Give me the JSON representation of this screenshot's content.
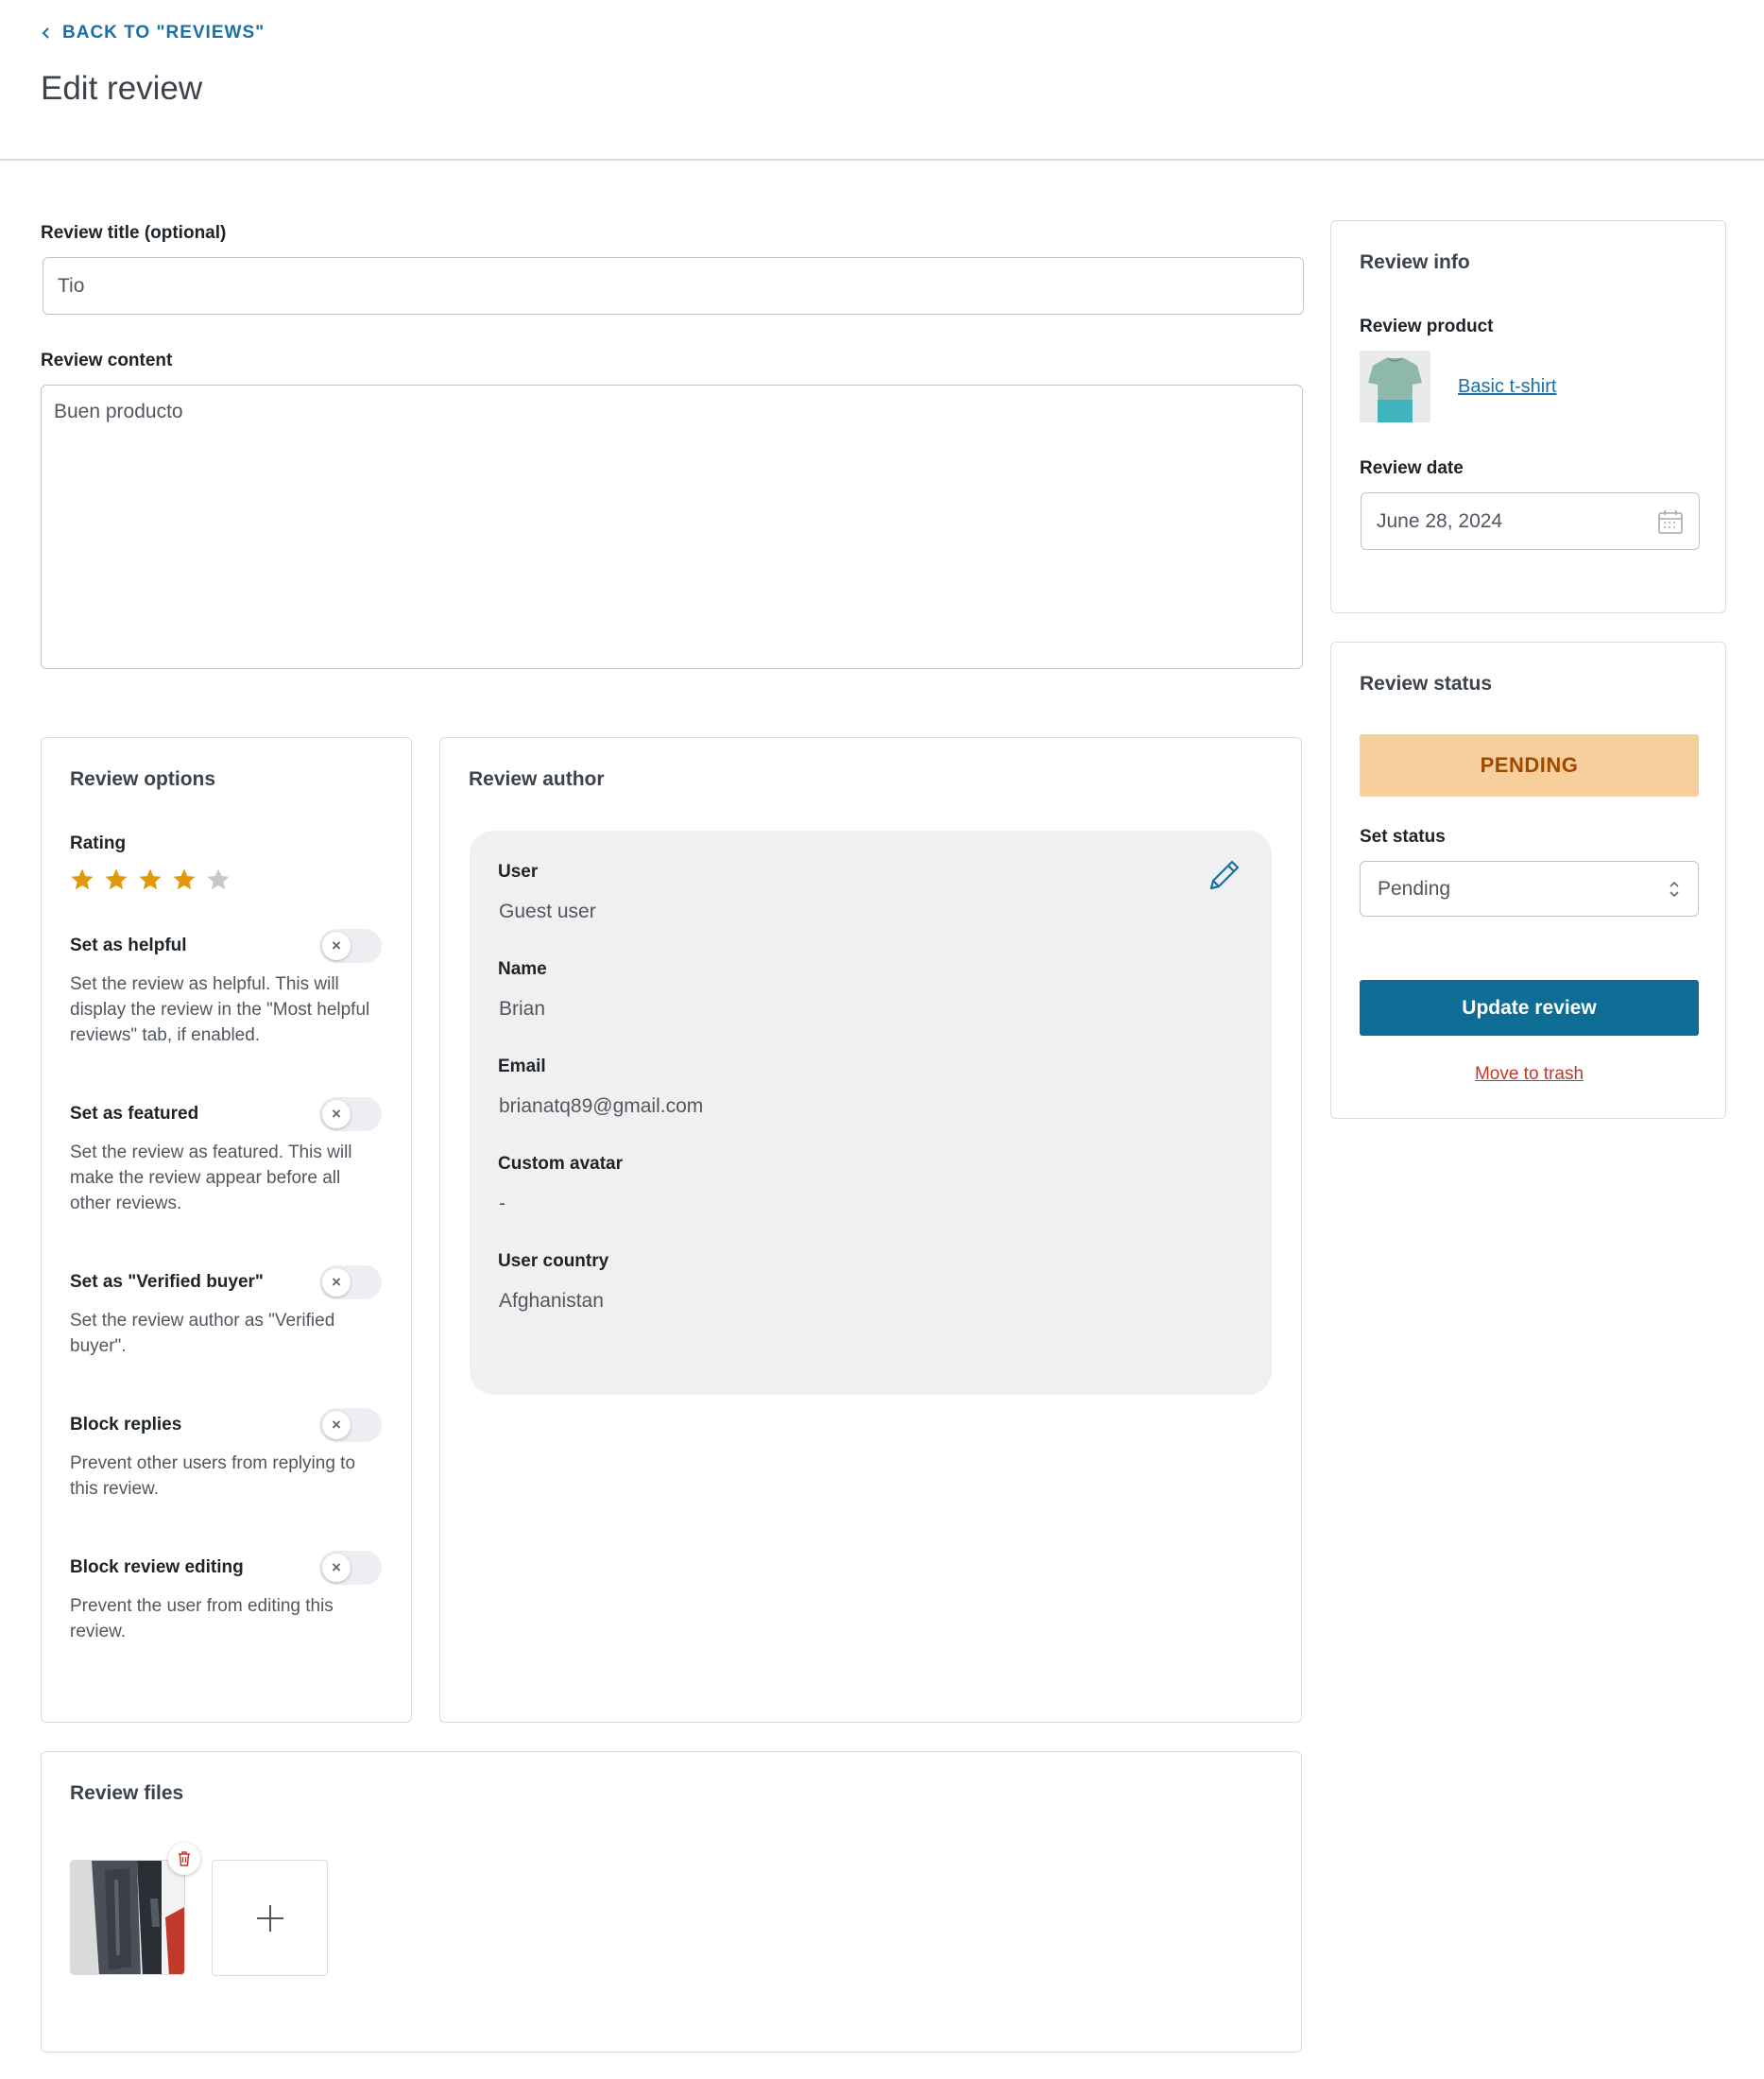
{
  "header": {
    "back_label": "BACK TO \"REVIEWS\"",
    "title": "Edit review"
  },
  "form": {
    "title_label": "Review title (optional)",
    "title_value": "Tio",
    "content_label": "Review content",
    "content_value": "Buen producto"
  },
  "options": {
    "title": "Review options",
    "rating_label": "Rating",
    "rating_value": 4,
    "rating_max": 5,
    "items": [
      {
        "label": "Set as helpful",
        "desc": "Set the review as helpful. This will display the review in the \"Most helpful reviews\" tab, if enabled.",
        "enabled": false
      },
      {
        "label": "Set as featured",
        "desc": "Set the review as featured. This will make the review appear before all other reviews.",
        "enabled": false
      },
      {
        "label": "Set as \"Verified buyer\"",
        "desc": "Set the review author as \"Verified buyer\".",
        "enabled": false
      },
      {
        "label": "Block replies",
        "desc": "Prevent other users from replying to this review.",
        "enabled": false
      },
      {
        "label": "Block review editing",
        "desc": "Prevent the user from editing this review.",
        "enabled": false
      }
    ]
  },
  "author": {
    "title": "Review author",
    "fields": [
      {
        "label": "User",
        "value": "Guest user"
      },
      {
        "label": "Name",
        "value": "Brian"
      },
      {
        "label": "Email",
        "value": "brianatq89@gmail.com"
      },
      {
        "label": "Custom avatar",
        "value": "-"
      },
      {
        "label": "User country",
        "value": "Afghanistan"
      }
    ],
    "edit_icon": "pencil-icon"
  },
  "files": {
    "title": "Review files",
    "add_icon": "plus-icon",
    "delete_icon": "trash-icon"
  },
  "info": {
    "title": "Review info",
    "product_label": "Review product",
    "product_name": "Basic t-shirt",
    "date_label": "Review date",
    "date_value": "June 28, 2024",
    "date_icon": "calendar-icon"
  },
  "status": {
    "title": "Review status",
    "badge": "PENDING",
    "set_label": "Set status",
    "select_value": "Pending",
    "update_label": "Update review",
    "trash_label": "Move to trash"
  },
  "colors": {
    "accent": "#0e6d94",
    "link": "#1a6fa3",
    "star": "#e09a0b",
    "star_empty": "#c8c8c8",
    "pending_bg": "#f6cf9c",
    "pending_text": "#a04a00",
    "danger": "#c0392b"
  }
}
